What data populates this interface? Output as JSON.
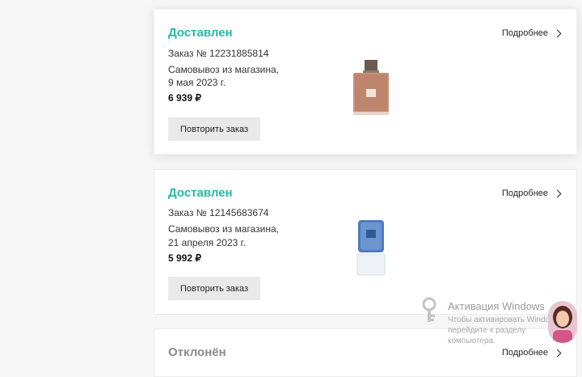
{
  "orders": [
    {
      "status": "Доставлен",
      "details_label": "Подробнее",
      "order_number": "Заказ № 12231885814",
      "delivery_line1": "Самовывоз из магазина,",
      "delivery_line2": "9 мая 2023 г.",
      "price": "6 939 ₽",
      "repeat_label": "Повторить заказ",
      "product_icon": "perfume-bottle-brown"
    },
    {
      "status": "Доставлен",
      "details_label": "Подробнее",
      "order_number": "Заказ № 12145683674",
      "delivery_line1": "Самовывоз из магазина,",
      "delivery_line2": "21 апреля 2023 г.",
      "price": "5 992 ₽",
      "repeat_label": "Повторить заказ",
      "product_icon": "perfume-bottle-blue"
    },
    {
      "status": "Отклонён",
      "details_label": "Подробнее"
    }
  ],
  "watermark": {
    "title": "Активация Windows",
    "line1": "Чтобы активировать Windows,",
    "line2": "перейдите к разделу",
    "line3": "компьютера."
  },
  "colors": {
    "delivered": "#26b8a6",
    "rejected": "#8a8a8a",
    "button_bg": "#e9e9e9"
  }
}
